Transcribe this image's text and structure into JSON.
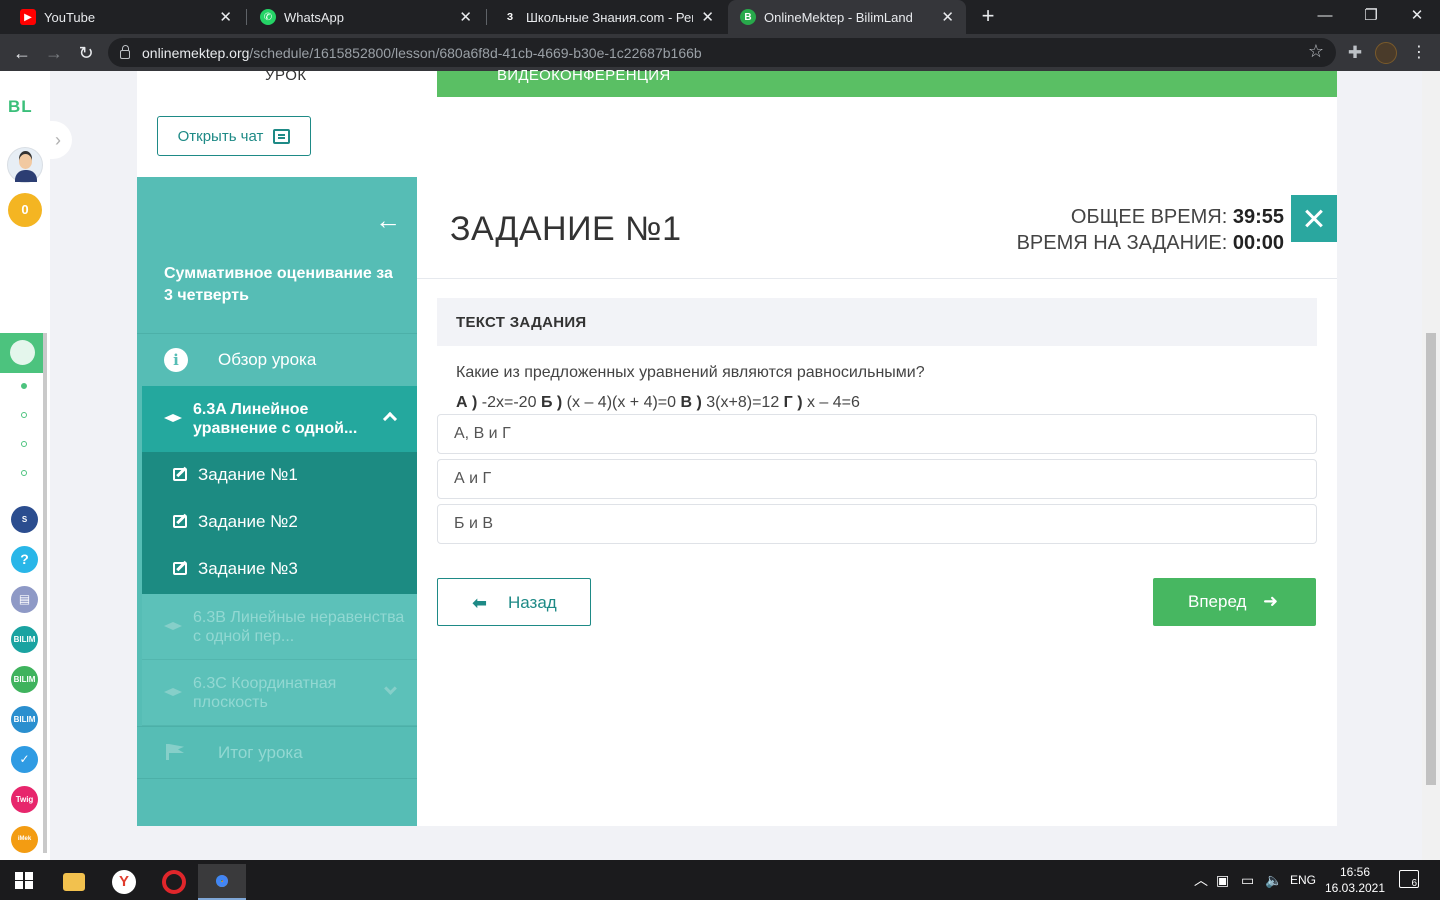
{
  "browser": {
    "tabs": [
      {
        "title": "YouTube",
        "color": "#ff0000",
        "glyph": "▶"
      },
      {
        "title": "WhatsApp",
        "color": "#25d366",
        "glyph": "✆"
      },
      {
        "title": "Школьные Знания.com - Решае",
        "color": "#202124",
        "glyph": "З"
      },
      {
        "title": "OnlineMektep - BilimLand",
        "color": "#28a94b",
        "glyph": "B"
      }
    ],
    "url_host": "onlinemektep.org",
    "url_path": "/schedule/1615852800/lesson/680a6f8d-41cb-4669-b30e-1c22687b166b"
  },
  "rail": {
    "logo": "BL",
    "score": "0",
    "apps": [
      {
        "name": "smart-nation",
        "color": "#2b4d8f",
        "text": "Smart"
      },
      {
        "name": "help",
        "color": "#29b6e8",
        "text": "?"
      },
      {
        "name": "tv",
        "color": "#8e99c6",
        "text": "▤"
      },
      {
        "name": "bilim-class",
        "color": "#1aa3a1",
        "text": "BILIM"
      },
      {
        "name": "bilimland",
        "color": "#3fb35d",
        "text": "BILIM"
      },
      {
        "name": "bilim-book",
        "color": "#2a8fcf",
        "text": "BILIM"
      },
      {
        "name": "test",
        "color": "#2f9be3",
        "text": "✓"
      },
      {
        "name": "twig",
        "color": "#e7266c",
        "text": "Twig"
      },
      {
        "name": "imektep",
        "color": "#f39c12",
        "text": "iMektep"
      }
    ]
  },
  "lesson": {
    "top_label": "УРОК",
    "banner": "ВИДЕОКОНФЕРЕНЦИЯ",
    "chat_button": "Открыть чат",
    "sidebar_title": "Суммативное оценивание за 3 четверть",
    "overview": "Обзор урока",
    "section_active": "6.3A Линейное уравнение с одной...",
    "tasks": [
      "Задание №1",
      "Задание №2",
      "Задание №3"
    ],
    "section_b": "6.3B Линейные неравенства с одной пер...",
    "section_c": "6.3C Координатная плоскость",
    "summary": "Итог урока"
  },
  "task": {
    "title": "ЗАДАНИЕ №1",
    "total_time_label": "ОБЩЕЕ ВРЕМЯ:",
    "total_time": "39:55",
    "task_time_label": "ВРЕМЯ НА ЗАДАНИЕ:",
    "task_time": "00:00",
    "text_header": "ТЕКСТ ЗАДАНИЯ",
    "question": "Какие из предложенных уравнений являются равносильными?",
    "equations": [
      {
        "letter": "А )",
        "eq": "-2х=-20"
      },
      {
        "letter": "Б )",
        "eq": "(х – 4)(х + 4)=0"
      },
      {
        "letter": "В )",
        "eq": "3(х+8)=12"
      },
      {
        "letter": "Г )",
        "eq": "х – 4=6"
      }
    ],
    "answers": [
      "А, В и Г",
      "А и Г",
      "Б и В"
    ],
    "back_button": "Назад",
    "next_button": "Вперед"
  },
  "taskbar": {
    "lang": "ENG",
    "time": "16:56",
    "date": "16.03.2021",
    "notifications": "6"
  }
}
